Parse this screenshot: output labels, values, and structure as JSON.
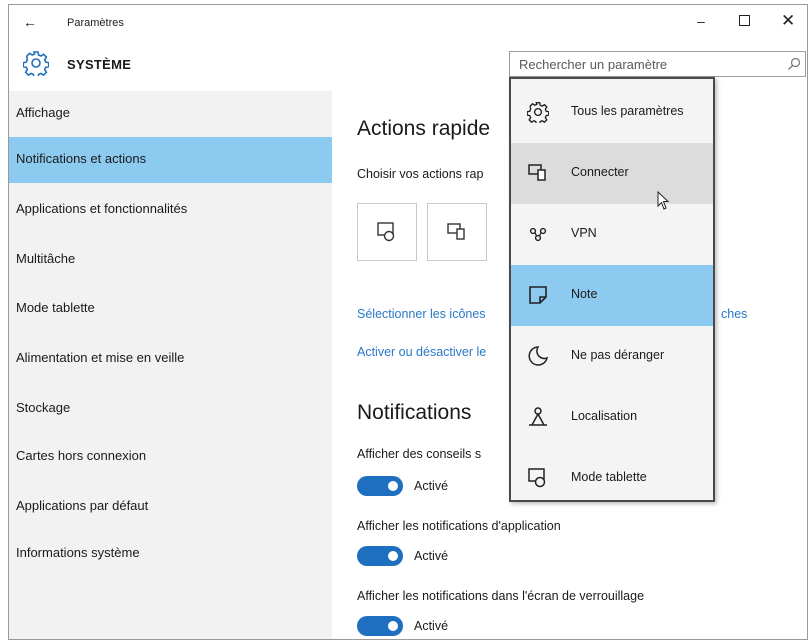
{
  "window": {
    "title": "Paramètres",
    "back": "←",
    "minimize": "–",
    "close": "✕"
  },
  "header": {
    "section": "SYSTÈME",
    "search_placeholder": "Rechercher un paramètre"
  },
  "sidebar": {
    "items": [
      {
        "label": "Affichage"
      },
      {
        "label": "Notifications et actions",
        "active": true
      },
      {
        "label": "Applications et fonctionnalités"
      },
      {
        "label": "Multitâche"
      },
      {
        "label": "Mode tablette"
      },
      {
        "label": "Alimentation et mise en veille"
      },
      {
        "label": "Stockage"
      },
      {
        "label": "Cartes hors connexion"
      },
      {
        "label": "Applications par défaut"
      },
      {
        "label": "Informations système"
      }
    ]
  },
  "main": {
    "quick_actions_heading": "Actions rapide",
    "quick_actions_subtitle": "Choisir vos actions rap",
    "link_select_icons": "Sélectionner les icônes",
    "link_select_icons_tail": "ches",
    "link_toggle_icons": "Activer ou désactiver le",
    "notifications_heading": "Notifications",
    "settings": [
      {
        "label": "Afficher des conseils s",
        "state": "Activé",
        "on": true
      },
      {
        "label": "Afficher les notifications d'application",
        "state": "Activé",
        "on": true
      },
      {
        "label": "Afficher les notifications dans l'écran de verrouillage",
        "state": "Activé",
        "on": true
      }
    ]
  },
  "flyout": {
    "items": [
      {
        "label": "Tous les paramètres",
        "icon": "gear-icon"
      },
      {
        "label": "Connecter",
        "icon": "connect-icon",
        "hover": true
      },
      {
        "label": "VPN",
        "icon": "vpn-icon"
      },
      {
        "label": "Note",
        "icon": "note-icon",
        "selected": true
      },
      {
        "label": "Ne pas déranger",
        "icon": "moon-icon"
      },
      {
        "label": "Localisation",
        "icon": "location-icon"
      },
      {
        "label": "Mode tablette",
        "icon": "tablet-mode-icon"
      }
    ]
  },
  "colors": {
    "accent": "#1e6fc0",
    "selection": "#8ccaf0",
    "link": "#2a78c8",
    "sidebar_bg": "#f2f2f2"
  }
}
